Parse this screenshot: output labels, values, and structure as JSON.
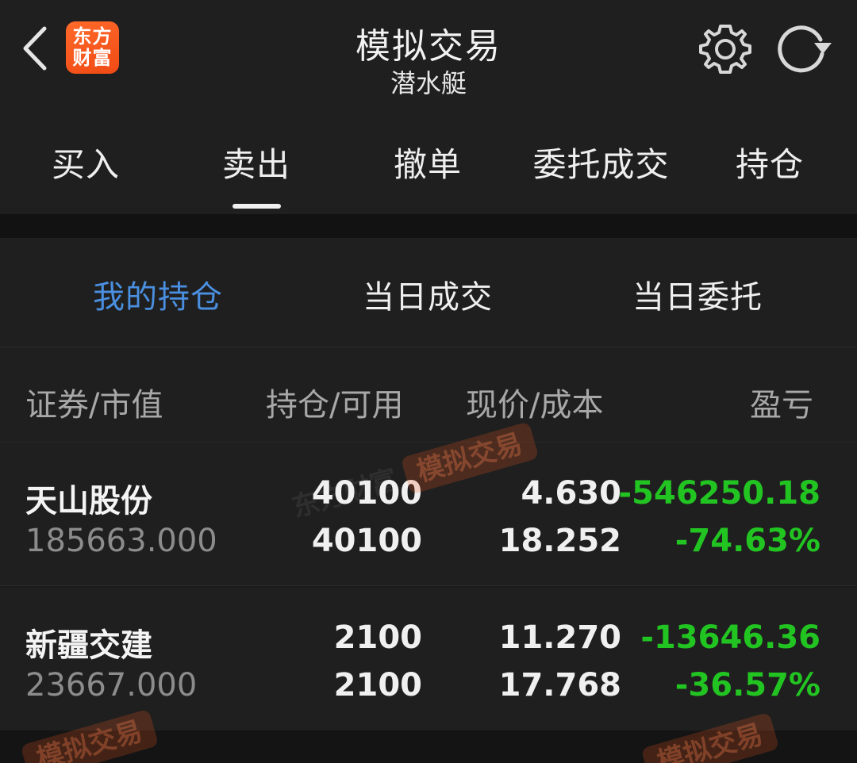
{
  "header": {
    "logo_line1": "东方",
    "logo_line2": "财富",
    "title": "模拟交易",
    "subtitle": "潜水艇"
  },
  "main_tabs": [
    {
      "label": "买入"
    },
    {
      "label": "卖出",
      "active": true
    },
    {
      "label": "撤单"
    },
    {
      "label": "委托成交"
    },
    {
      "label": "持仓"
    }
  ],
  "sub_tabs": [
    {
      "label": "我的持仓",
      "active": true
    },
    {
      "label": "当日成交"
    },
    {
      "label": "当日委托"
    }
  ],
  "columns": {
    "security": "证券/市值",
    "position": "持仓/可用",
    "price": "现价/成本",
    "pnl": "盈亏"
  },
  "holdings": [
    {
      "name": "天山股份",
      "market_value": "185663.000",
      "position": "40100",
      "available": "40100",
      "price": "4.630",
      "cost": "18.252",
      "pnl": "-546250.18",
      "pnl_pct": "-74.63%"
    },
    {
      "name": "新疆交建",
      "market_value": "23667.000",
      "position": "2100",
      "available": "2100",
      "price": "11.270",
      "cost": "17.768",
      "pnl": "-13646.36",
      "pnl_pct": "-36.57%"
    }
  ],
  "watermark": {
    "brand": "东方财富",
    "label": "模拟交易"
  },
  "colors": {
    "active_tab": "#4a8fe0",
    "loss": "#22c422",
    "brand": "#f04a14"
  }
}
